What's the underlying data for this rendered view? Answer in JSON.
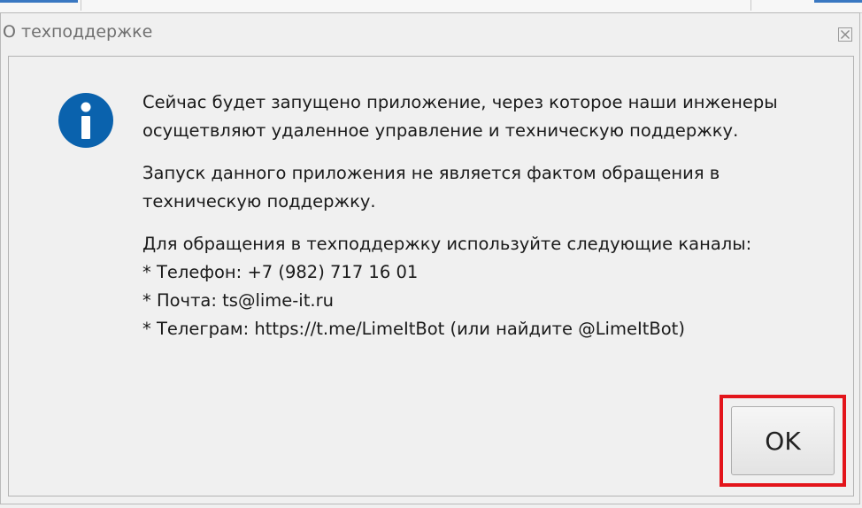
{
  "dialog": {
    "title": "О техподдержке",
    "close_icon": "close-x-icon",
    "icon": "info-icon",
    "accent_color": "#0a62ad",
    "highlight_color": "#e3151b",
    "paragraphs": [
      "Сейчас будет запущено приложение, через которое наши инженеры\nосущетвляют удаленное управление и техническую поддержку.",
      "Запуск данного приложения не является фактом обращения в\nтехническую поддержку.",
      "Для обращения в техподдержку используйте следующие каналы:\n  * Телефон: +7 (982) 717 16 01\n  * Почта: ts@lime-it.ru\n  * Телеграм: https://t.me/LimeItBot (или найдите @LimeItBot)"
    ],
    "ok_label": "OK"
  }
}
